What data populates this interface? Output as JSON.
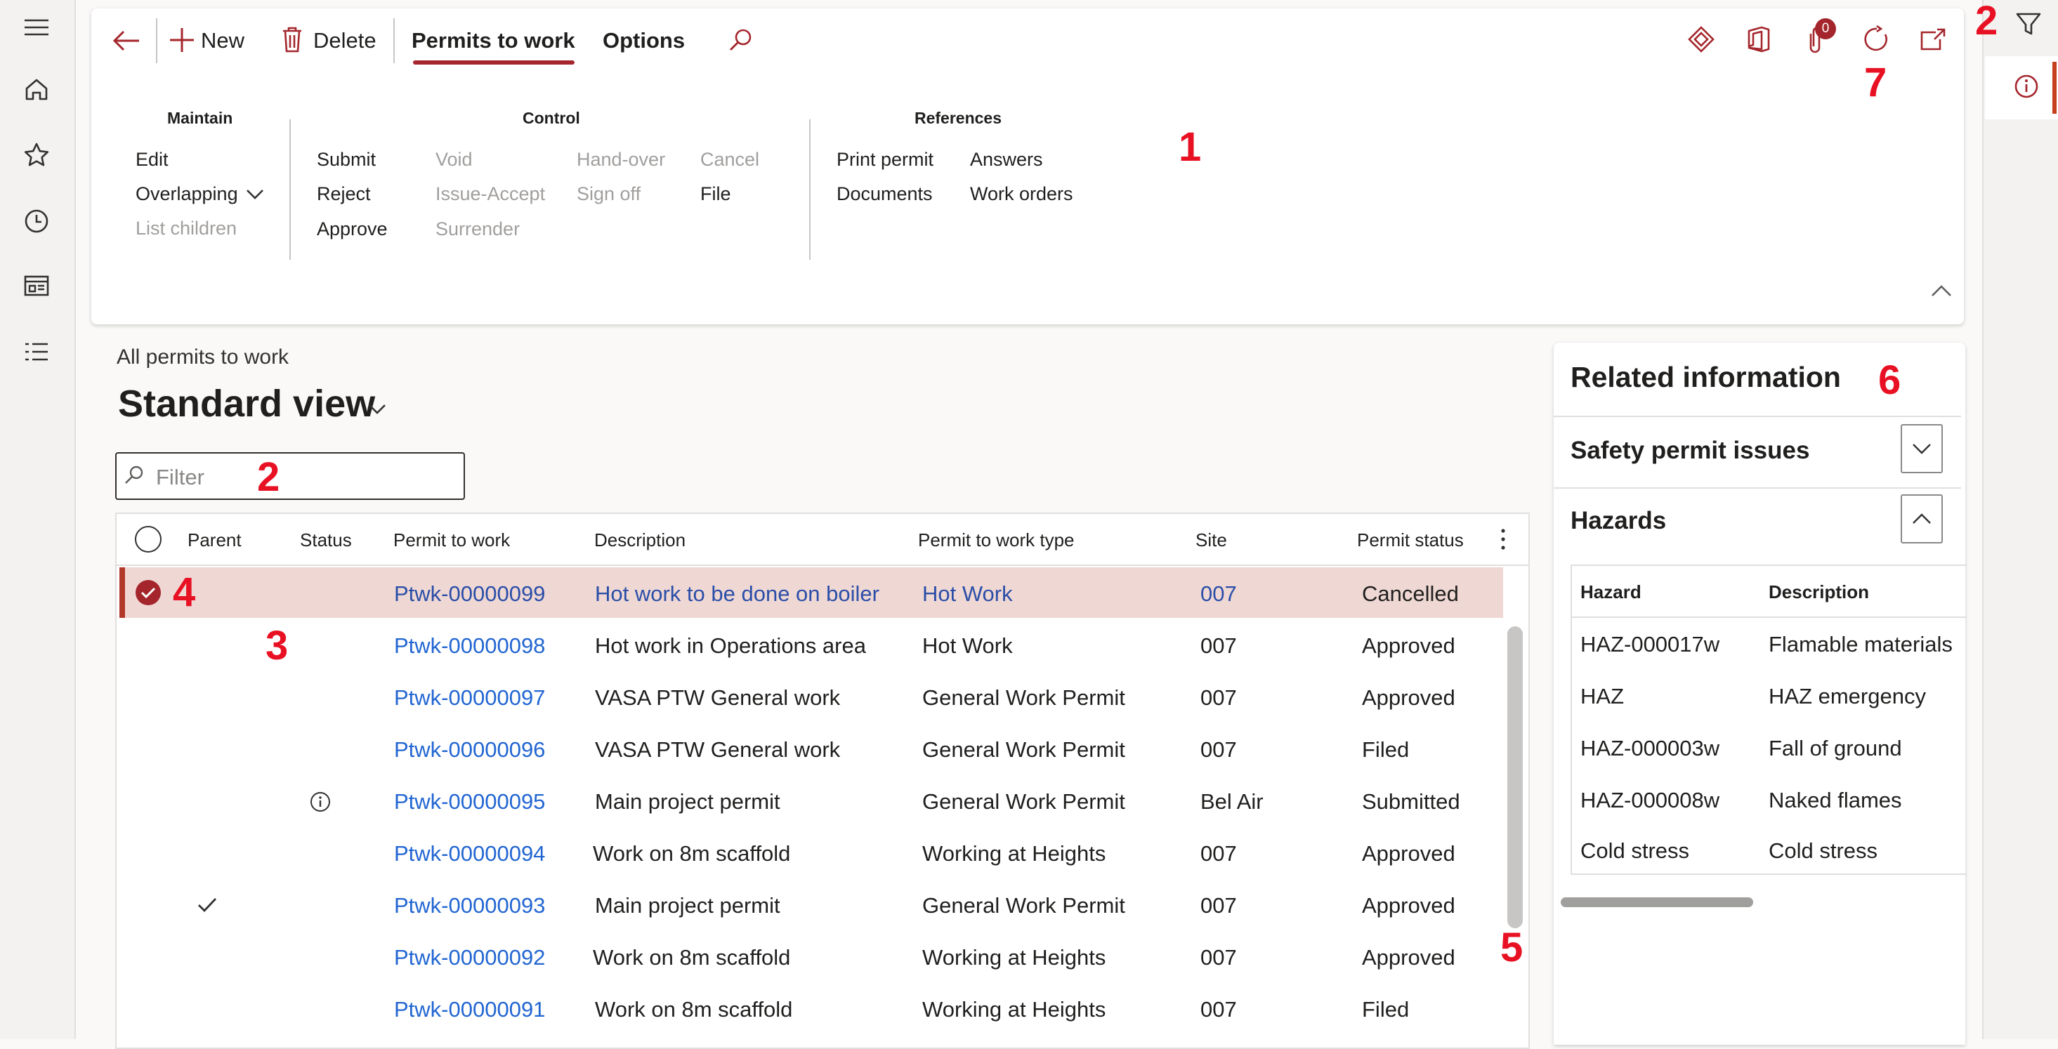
{
  "leftnav": {
    "icons": [
      "hamburger-menu-icon",
      "home-icon",
      "star-icon",
      "clock-icon",
      "workspace-icon",
      "list-icon"
    ]
  },
  "toolbar": {
    "new_label": "New",
    "delete_label": "Delete",
    "tab_active": "Permits to work",
    "tab_options": "Options",
    "attachments_badge": "0"
  },
  "ribbon": {
    "maintain": {
      "title": "Maintain",
      "edit": "Edit",
      "overlapping": "Overlapping",
      "list_children": "List children"
    },
    "control": {
      "title": "Control",
      "submit": "Submit",
      "reject": "Reject",
      "approve": "Approve",
      "void": "Void",
      "issue_accept": "Issue-Accept",
      "surrender": "Surrender",
      "hand_over": "Hand-over",
      "sign_off": "Sign off",
      "cancel": "Cancel",
      "file": "File"
    },
    "references": {
      "title": "References",
      "print_permit": "Print permit",
      "documents": "Documents",
      "answers": "Answers",
      "work_orders": "Work orders"
    }
  },
  "callouts": {
    "c1": "1",
    "c2a": "2",
    "c2b": "2",
    "c3": "3",
    "c4": "4",
    "c5": "5",
    "c6": "6",
    "c7": "7"
  },
  "list": {
    "breadcrumb": "All permits to work",
    "view_name": "Standard view",
    "filter_placeholder": "Filter",
    "columns": {
      "parent": "Parent",
      "status": "Status",
      "permit": "Permit to work",
      "description": "Description",
      "type": "Permit to work type",
      "site": "Site",
      "permit_status": "Permit status"
    },
    "rows": [
      {
        "permit": "Ptwk-00000099",
        "description": "Hot work to be done on boiler",
        "type": "Hot Work",
        "site": "007",
        "permit_status": "Cancelled"
      },
      {
        "permit": "Ptwk-00000098",
        "description": "Hot work in Operations area",
        "type": "Hot Work",
        "site": "007",
        "permit_status": "Approved"
      },
      {
        "permit": "Ptwk-00000097",
        "description": "VASA PTW General work",
        "type": "General Work Permit",
        "site": "007",
        "permit_status": "Approved"
      },
      {
        "permit": "Ptwk-00000096",
        "description": "VASA PTW General work",
        "type": "General Work Permit",
        "site": "007",
        "permit_status": "Filed"
      },
      {
        "permit": "Ptwk-00000095",
        "description": "Main project permit",
        "type": "General Work Permit",
        "site": "Bel Air",
        "permit_status": "Submitted"
      },
      {
        "permit": "Ptwk-00000094",
        "description": "Work on 8m scaffold",
        "type": "Working at Heights",
        "site": "007",
        "permit_status": "Approved"
      },
      {
        "permit": "Ptwk-00000093",
        "description": "Main project permit",
        "type": "General Work Permit",
        "site": "007",
        "permit_status": "Approved"
      },
      {
        "permit": "Ptwk-00000092",
        "description": "Work on 8m scaffold",
        "type": "Working at Heights",
        "site": "007",
        "permit_status": "Approved"
      },
      {
        "permit": "Ptwk-00000091",
        "description": "Work on 8m scaffold",
        "type": "Working at Heights",
        "site": "007",
        "permit_status": "Filed"
      }
    ]
  },
  "related": {
    "title": "Related information",
    "safety_title": "Safety permit issues",
    "hazards_title": "Hazards",
    "hazard_col": "Hazard",
    "description_col": "Description",
    "hazards": [
      {
        "hazard": "HAZ-000017w",
        "description": "Flamable materials"
      },
      {
        "hazard": "HAZ",
        "description": "HAZ emergency"
      },
      {
        "hazard": "HAZ-000003w",
        "description": "Fall of ground"
      },
      {
        "hazard": "HAZ-000008w",
        "description": "Naked flames"
      },
      {
        "hazard": "Cold stress",
        "description": "Cold stress"
      }
    ]
  },
  "colors": {
    "accent": "#a4262c",
    "link": "#2266d2",
    "selected_row": "#efd8d4",
    "callout": "#e81123"
  }
}
